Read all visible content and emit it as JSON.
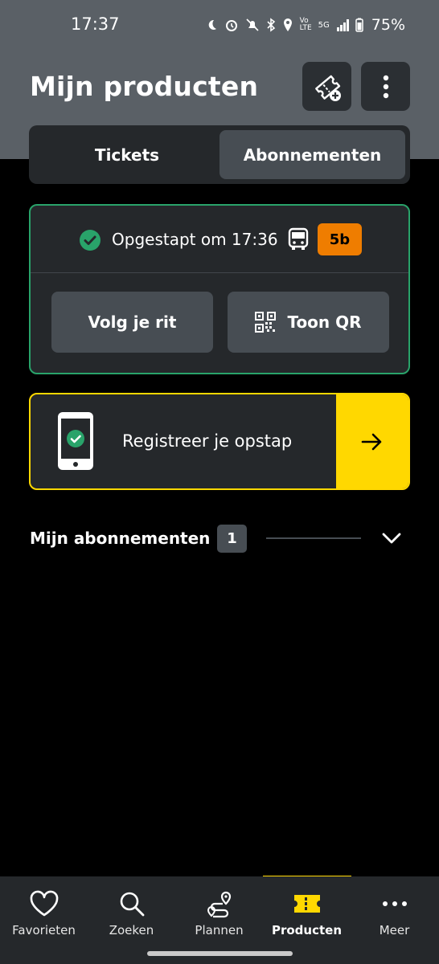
{
  "status_bar": {
    "time": "17:37",
    "network": "5G",
    "battery": "75%"
  },
  "header": {
    "title": "Mijn producten"
  },
  "tabs": [
    {
      "label": "Tickets",
      "active": false
    },
    {
      "label": "Abonnementen",
      "active": true
    }
  ],
  "checkin": {
    "status_text": "Opgestapt om 17:36",
    "line": "5b",
    "line_color": "#ef7d00",
    "border_color": "#29a36a",
    "follow_label": "Volg je rit",
    "qr_label": "Toon QR"
  },
  "register": {
    "label": "Registreer je opstap",
    "accent": "#ffd800"
  },
  "subscriptions": {
    "title": "Mijn abonnementen",
    "count": "1"
  },
  "bottom_nav": [
    {
      "label": "Favorieten",
      "icon": "heart-icon"
    },
    {
      "label": "Zoeken",
      "icon": "search-icon"
    },
    {
      "label": "Plannen",
      "icon": "route-icon"
    },
    {
      "label": "Producten",
      "icon": "ticket-icon",
      "active": true
    },
    {
      "label": "Meer",
      "icon": "more-horizontal-icon"
    }
  ]
}
